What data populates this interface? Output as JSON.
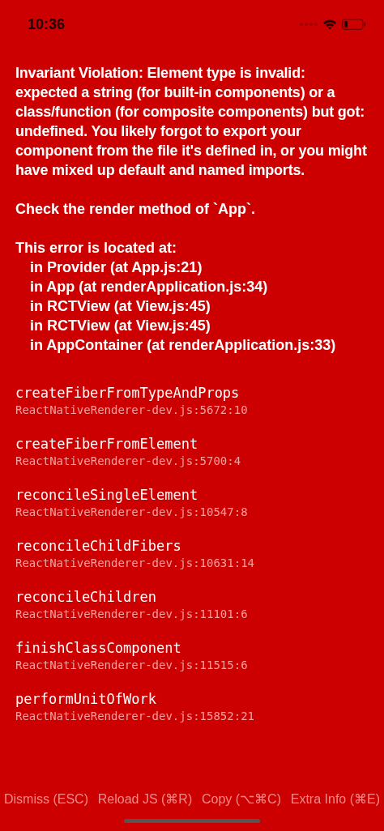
{
  "status_bar": {
    "time": "10:36"
  },
  "message": "Invariant Violation: Element type is invalid: expected a string (for built-in components) or a class/function (for composite components) but got: undefined. You likely forgot to export your component from the file it's defined in, or you might have mixed up default and named imports.",
  "render_check": "Check the render method of `App`.",
  "location": {
    "heading": "This error is located at:",
    "frames": [
      "in Provider (at App.js:21)",
      "in App (at renderApplication.js:34)",
      "in RCTView (at View.js:45)",
      "in RCTView (at View.js:45)",
      "in AppContainer (at renderApplication.js:33)"
    ]
  },
  "stack": [
    {
      "method": "createFiberFromTypeAndProps",
      "file": "ReactNativeRenderer-dev.js:5672:10"
    },
    {
      "method": "createFiberFromElement",
      "file": "ReactNativeRenderer-dev.js:5700:4"
    },
    {
      "method": "reconcileSingleElement",
      "file": "ReactNativeRenderer-dev.js:10547:8"
    },
    {
      "method": "reconcileChildFibers",
      "file": "ReactNativeRenderer-dev.js:10631:14"
    },
    {
      "method": "reconcileChildren",
      "file": "ReactNativeRenderer-dev.js:11101:6"
    },
    {
      "method": "finishClassComponent",
      "file": "ReactNativeRenderer-dev.js:11515:6"
    },
    {
      "method": "performUnitOfWork",
      "file": "ReactNativeRenderer-dev.js:15852:21"
    }
  ],
  "buttons": [
    "Dismiss (ESC)",
    "Reload JS (⌘R)",
    "Copy (⌥⌘C)",
    "Extra Info (⌘E)"
  ]
}
